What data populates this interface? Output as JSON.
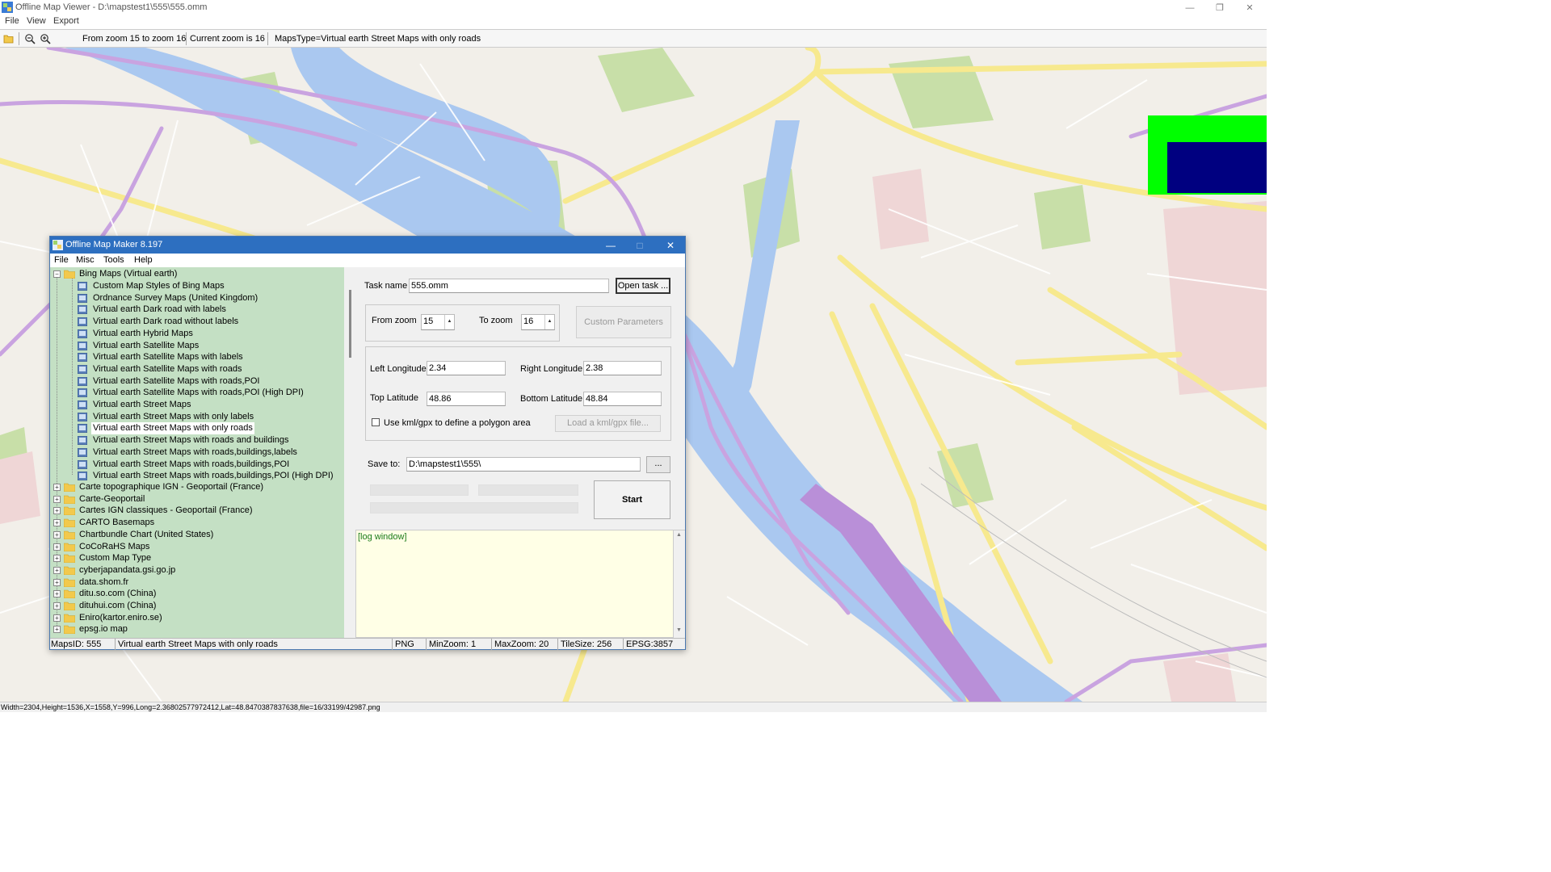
{
  "window": {
    "title": "Offline Map Viewer - D:\\mapstest1\\555\\555.omm",
    "controls": {
      "minimize": "—",
      "restore": "❐",
      "close": "✕"
    }
  },
  "menubar": [
    "File",
    "View",
    "Export"
  ],
  "toolbar": {
    "zoom_range": "From zoom 15 to zoom 16",
    "current_zoom": "Current zoom is 16",
    "maps_type": "MapsType=Virtual earth Street Maps with only roads",
    "icons": [
      "open-folder-icon",
      "zoom-out-icon",
      "zoom-in-icon"
    ]
  },
  "status_bar": "Width=2304,Height=1536,X=1558,Y=996,Long=2.36802577972412,Lat=48.8470387837638,file=16/33199/42987.png",
  "dialog": {
    "title": "Offline Map Maker 8.197",
    "menu": [
      "File",
      "Misc",
      "Tools",
      "Help"
    ],
    "tree": {
      "root": "Bing Maps (Virtual earth)",
      "children": [
        "Custom Map Styles of Bing Maps",
        "Ordnance Survey Maps (United Kingdom)",
        "Virtual earth Dark road with labels",
        "Virtual earth Dark road without labels",
        "Virtual earth Hybrid Maps",
        "Virtual earth Satellite Maps",
        "Virtual earth Satellite Maps with labels",
        "Virtual earth Satellite Maps with roads",
        "Virtual earth Satellite Maps with roads,POI",
        "Virtual earth Satellite Maps with roads,POI (High DPI)",
        "Virtual earth Street Maps",
        "Virtual earth Street Maps with only labels",
        "Virtual earth Street Maps with only roads",
        "Virtual earth Street Maps with roads and buildings",
        "Virtual earth Street Maps with roads,buildings,labels",
        "Virtual earth Street Maps with roads,buildings,POI",
        "Virtual earth Street Maps with roads,buildings,POI (High DPI)"
      ],
      "selected": "Virtual earth Street Maps with only roads",
      "folders": [
        "Carte topographique IGN - Geoportail (France)",
        "Carte-Geoportail",
        "Cartes IGN classiques - Geoportail (France)",
        "CARTO Basemaps",
        "Chartbundle Chart (United States)",
        "CoCoRaHS Maps",
        "Custom Map Type",
        "cyberjapandata.gsi.go.jp",
        "data.shom.fr",
        "ditu.so.com (China)",
        "dituhui.com (China)",
        "Eniro(kartor.eniro.se)",
        "epsg.io map"
      ]
    },
    "form": {
      "task_name_label": "Task name",
      "task_name_value": "555.omm",
      "open_task_button": "Open task ...",
      "from_zoom_label": "From zoom",
      "from_zoom_value": "15",
      "to_zoom_label": "To zoom",
      "to_zoom_value": "16",
      "custom_parameters_button": "Custom Parameters",
      "left_longitude_label": "Left Longitude",
      "left_longitude_value": "2.34",
      "right_longitude_label": "Right Longitude",
      "right_longitude_value": "2.38",
      "top_latitude_label": "Top Latitude",
      "top_latitude_value": "48.86",
      "bottom_latitude_label": "Bottom Latitude",
      "bottom_latitude_value": "48.84",
      "kml_checkbox_label": "Use kml/gpx to define a polygon area",
      "kml_checked": false,
      "load_kml_button": "Load a kml/gpx file...",
      "save_to_label": "Save to:",
      "save_to_value": "D:\\mapstest1\\555\\",
      "browse_button": "...",
      "start_button": "Start",
      "log_text": "[log window]"
    },
    "status": {
      "maps_id": "MapsID: 555",
      "map_name": "Virtual earth Street Maps with only roads",
      "format": "PNG",
      "min_zoom": "MinZoom: 1",
      "max_zoom": "MaxZoom: 20",
      "tile_size": "TileSize: 256",
      "epsg": "EPSG:3857"
    }
  },
  "colors": {
    "tree_bg": "#c4e0c4",
    "log_bg": "#ffffe6",
    "dialog_title": "#2d6fc0",
    "map_water": "#aac8f0",
    "map_road_yellow": "#f7e98e",
    "map_road_purple": "#c9a3e0",
    "map_park": "#c8dfa8",
    "overview_bg": "#00ff00",
    "overview_viewport": "#000080"
  }
}
